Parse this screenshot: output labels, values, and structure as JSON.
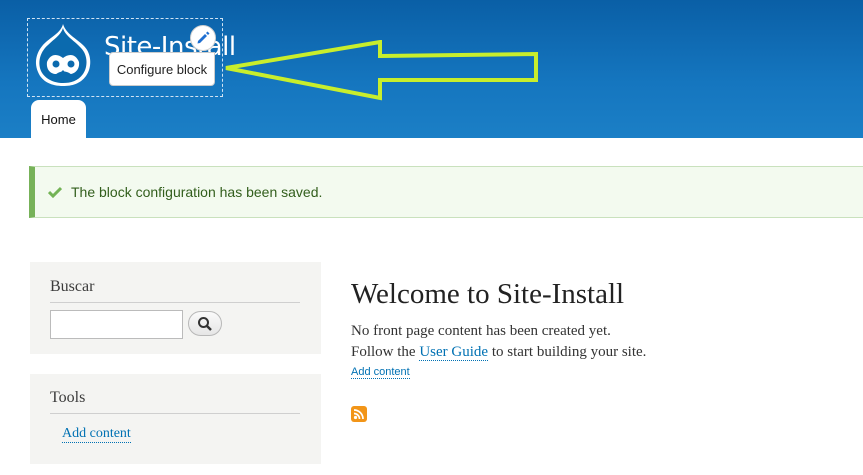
{
  "header": {
    "site_name": "Site-Install",
    "context_menu_label": "Configure block",
    "tabs": [
      {
        "label": "Home"
      }
    ]
  },
  "status": {
    "message": "The block configuration has been saved."
  },
  "sidebar": {
    "search_block": {
      "title": "Buscar",
      "input_value": ""
    },
    "tools_block": {
      "title": "Tools",
      "link": "Add content"
    }
  },
  "main": {
    "title": "Welcome to Site-Install",
    "line1": "No front page content has been created yet.",
    "line2_prefix": "Follow the ",
    "line2_link": "User Guide",
    "line2_suffix": " to start building your site.",
    "add_content": "Add content"
  },
  "colors": {
    "header": "#1576bf",
    "status_border": "#77b259",
    "link": "#0071b3",
    "arrow": "#c8ee2c"
  },
  "icons": {
    "logo": "drupal-drop-icon",
    "pencil": "pencil-icon",
    "check": "check-icon",
    "search": "magnifier-icon",
    "rss": "rss-icon"
  }
}
